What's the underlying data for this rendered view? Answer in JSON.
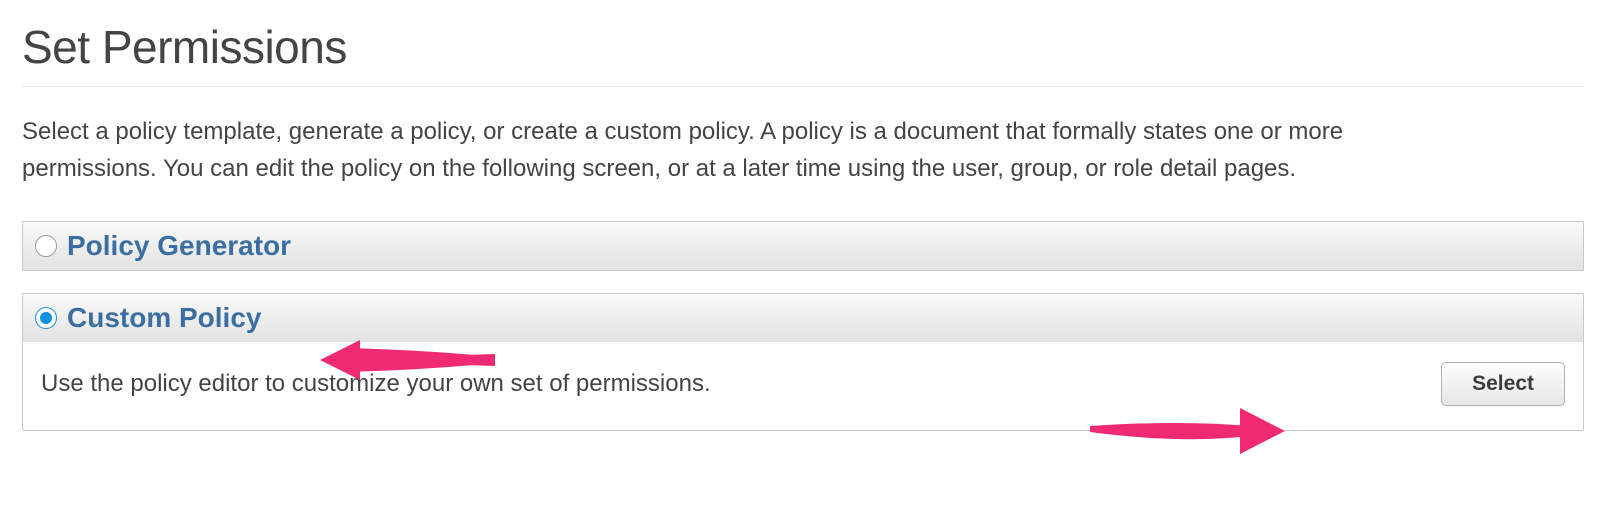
{
  "page": {
    "title": "Set Permissions",
    "intro": "Select a policy template, generate a policy, or create a custom policy. A policy is a document that formally states one or more permissions. You can edit the policy on the following screen, or at a later time using the user, group, or role detail pages."
  },
  "options": {
    "policy_generator": {
      "label": "Policy Generator",
      "selected": false
    },
    "custom_policy": {
      "label": "Custom Policy",
      "selected": true,
      "description": "Use the policy editor to customize your own set of permissions.",
      "button_label": "Select"
    }
  },
  "annotation": {
    "arrow_color": "#ef2a73"
  }
}
